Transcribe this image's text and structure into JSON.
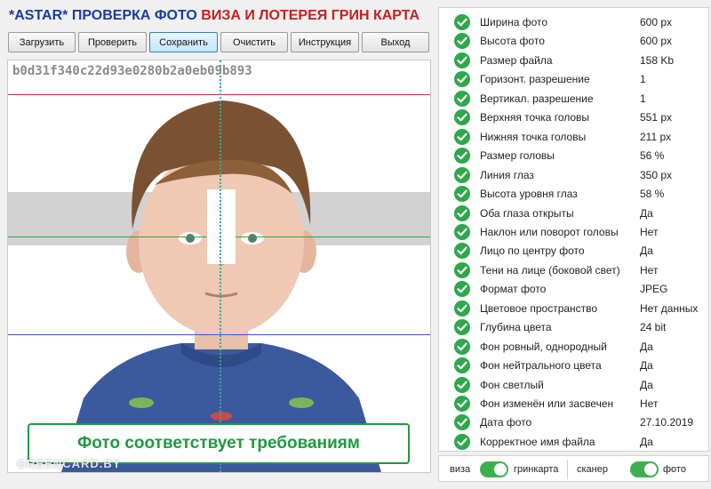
{
  "header": {
    "title_part1": "*ASTAR* ПРОВЕРКА ФОТО",
    "title_part2": "ВИЗА И ЛОТЕРЕЯ ГРИН КАРТА"
  },
  "toolbar": {
    "buttons": [
      "Загрузить",
      "Проверить",
      "Сохранить",
      "Очистить",
      "Инструкция",
      "Выход"
    ],
    "active_button": "Сохранить"
  },
  "photo": {
    "hash": "b0d31f340c22d93e0280b2a0eb09b893",
    "result_message": "Фото соответствует требованиям",
    "watermark": "GREENCARD.BY",
    "line_colors": {
      "top": "#cc3333",
      "eyes": "#2aa84a",
      "chin": "#3355cc",
      "center": "#3aa3a3"
    }
  },
  "checks": [
    {
      "label": "Ширина фото",
      "value": "600 px"
    },
    {
      "label": "Высота фото",
      "value": "600 px"
    },
    {
      "label": "Размер файла",
      "value": "158 Kb"
    },
    {
      "label": "Горизонт. разрешение",
      "value": "1"
    },
    {
      "label": "Вертикал. разрешение",
      "value": "1"
    },
    {
      "label": "Верхняя точка головы",
      "value": "551 px"
    },
    {
      "label": "Нижняя точка головы",
      "value": "211 px"
    },
    {
      "label": "Размер головы",
      "value": "56 %"
    },
    {
      "label": "Линия глаз",
      "value": "350 px"
    },
    {
      "label": "Высота уровня глаз",
      "value": "58 %"
    },
    {
      "label": "Оба глаза открыты",
      "value": "Да"
    },
    {
      "label": "Наклон или поворот головы",
      "value": "Нет"
    },
    {
      "label": "Лицо по центру фото",
      "value": "Да"
    },
    {
      "label": "Тени на лице (боковой свет)",
      "value": "Нет"
    },
    {
      "label": "Формат фото",
      "value": "JPEG"
    },
    {
      "label": "Цветовое пространство",
      "value": "Нет данных"
    },
    {
      "label": "Глубина цвета",
      "value": "24 bit"
    },
    {
      "label": "Фон ровный, однородный",
      "value": "Да"
    },
    {
      "label": "Фон нейтрального цвета",
      "value": "Да"
    },
    {
      "label": "Фон светлый",
      "value": "Да"
    },
    {
      "label": "Фон изменён или засвечен",
      "value": "Нет"
    },
    {
      "label": "Дата фото",
      "value": "27.10.2019"
    },
    {
      "label": "Корректное имя файла",
      "value": "Да"
    }
  ],
  "check_icon": "check-circle-icon",
  "accent_green": "#2ea84a",
  "bottom": {
    "toggle1_left": "виза",
    "toggle1_right": "гринкарта",
    "toggle2_left": "сканер",
    "toggle2_right": "фото"
  }
}
